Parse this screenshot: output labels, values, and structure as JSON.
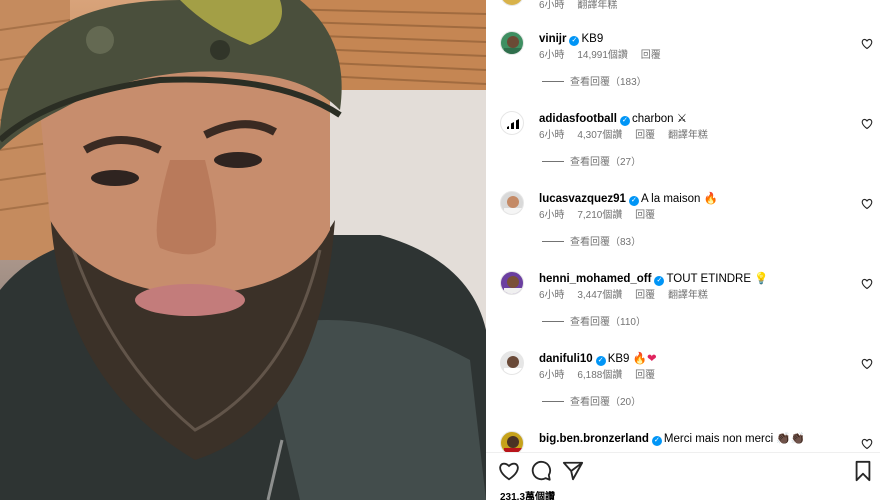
{
  "post": {
    "likes_text": "231.3萬個讚"
  },
  "top_comment": {
    "time": "6小時",
    "translate": "翻譯年糕"
  },
  "comments": [
    {
      "username": "vinijr",
      "text": "KB9",
      "emoji": "",
      "time": "6小時",
      "likes": "14,991個讚",
      "reply": "回覆",
      "translate": "",
      "view_replies": "查看回覆（183）"
    },
    {
      "username": "adidasfootball",
      "text": "charbon",
      "emoji": "⚔",
      "time": "6小時",
      "likes": "4,307個讚",
      "reply": "回覆",
      "translate": "翻譯年糕",
      "view_replies": "查看回覆（27）"
    },
    {
      "username": "lucasvazquez91",
      "text": "A la maison",
      "emoji": "🔥",
      "time": "6小時",
      "likes": "7,210個讚",
      "reply": "回覆",
      "translate": "",
      "view_replies": "查看回覆（83）"
    },
    {
      "username": "henni_mohamed_off",
      "text": "TOUT ETINDRE",
      "emoji": "💡",
      "time": "6小時",
      "likes": "3,447個讚",
      "reply": "回覆",
      "translate": "翻譯年糕",
      "view_replies": "查看回覆（110）"
    },
    {
      "username": "danifuli10",
      "text": "KB9",
      "emoji": "🔥❤",
      "time": "6小時",
      "likes": "6,188個讚",
      "reply": "回覆",
      "translate": "",
      "view_replies": "查看回覆（20）"
    },
    {
      "username": "big.ben.bronzerland",
      "text": "Merci mais non merci",
      "emoji": "👏🏿👏🏿",
      "time": "",
      "likes": "",
      "reply": "",
      "translate": "",
      "view_replies": ""
    }
  ],
  "icons": {
    "like": "heart-icon",
    "comment": "comment-icon",
    "share": "send-icon",
    "save": "bookmark-icon",
    "verified": "verified-badge-icon"
  },
  "colors": {
    "verified": "#0095f6",
    "meta_text": "#737373",
    "avatar_vinijr": "#3f8f62",
    "avatar_adidas": "#ffffff",
    "avatar_lucas": "#d9d9d9",
    "avatar_henni": "#6b3fa0",
    "avatar_dani": "#e6e6e6",
    "avatar_ben": "#c6a21b"
  }
}
